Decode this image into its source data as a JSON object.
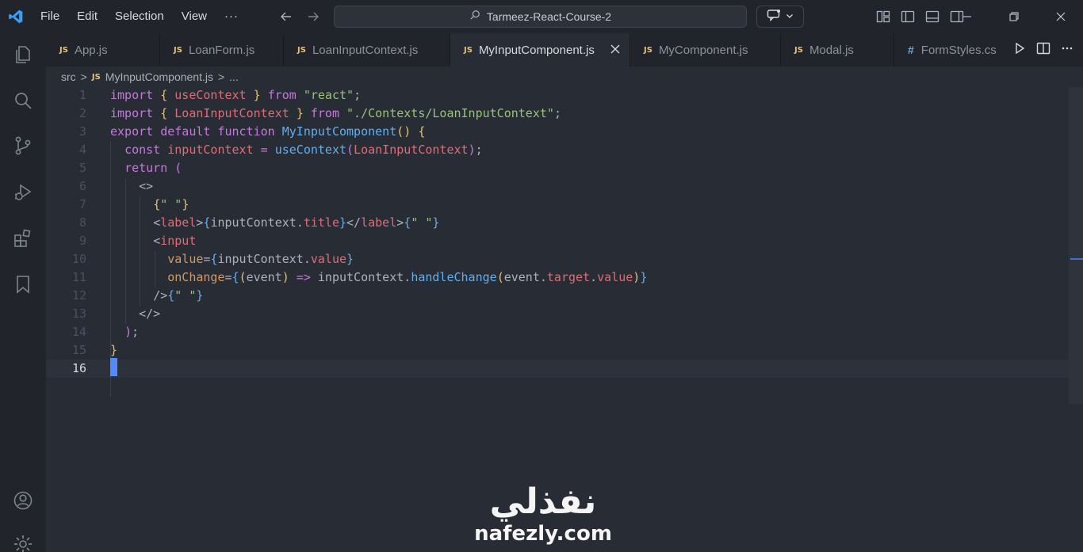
{
  "titlebar": {
    "menu": [
      "File",
      "Edit",
      "Selection",
      "View",
      "···"
    ],
    "command_center": "Tarmeez-React-Course-2"
  },
  "tabs": [
    {
      "badge": "JS",
      "label": "App.js"
    },
    {
      "badge": "JS",
      "label": "LoanForm.js"
    },
    {
      "badge": "JS",
      "label": "LoanInputContext.js"
    },
    {
      "badge": "JS",
      "label": "MyInputComponent.js",
      "active": true
    },
    {
      "badge": "JS",
      "label": "MyComponent.js"
    },
    {
      "badge": "JS",
      "label": "Modal.js"
    },
    {
      "badge": "#",
      "label": "FormStyles.cs"
    }
  ],
  "breadcrumb": {
    "folder": "src",
    "separator": ">",
    "file_badge": "JS",
    "file": "MyInputComponent.js",
    "separator2": ">",
    "symbol": "..."
  },
  "editor": {
    "current_line": 16,
    "lines": [
      {
        "n": "1",
        "tokens": [
          [
            "kw",
            "import"
          ],
          [
            "plain",
            " "
          ],
          [
            "br1",
            "{"
          ],
          [
            "plain",
            " "
          ],
          [
            "var",
            "useContext"
          ],
          [
            "plain",
            " "
          ],
          [
            "br1",
            "}"
          ],
          [
            "plain",
            " "
          ],
          [
            "kw",
            "from"
          ],
          [
            "plain",
            " "
          ],
          [
            "str",
            "\"react\""
          ],
          [
            "pun",
            ";"
          ]
        ]
      },
      {
        "n": "2",
        "tokens": [
          [
            "kw",
            "import"
          ],
          [
            "plain",
            " "
          ],
          [
            "br1",
            "{"
          ],
          [
            "plain",
            " "
          ],
          [
            "var",
            "LoanInputContext"
          ],
          [
            "plain",
            " "
          ],
          [
            "br1",
            "}"
          ],
          [
            "plain",
            " "
          ],
          [
            "kw",
            "from"
          ],
          [
            "plain",
            " "
          ],
          [
            "str",
            "\"./Contexts/LoanInputContext\""
          ],
          [
            "pun",
            ";"
          ]
        ]
      },
      {
        "n": "3",
        "tokens": [
          [
            "kw",
            "export"
          ],
          [
            "plain",
            " "
          ],
          [
            "kw",
            "default"
          ],
          [
            "plain",
            " "
          ],
          [
            "kw",
            "function"
          ],
          [
            "plain",
            " "
          ],
          [
            "fn",
            "MyInputComponent"
          ],
          [
            "br1",
            "()"
          ],
          [
            "plain",
            " "
          ],
          [
            "br1",
            "{"
          ]
        ]
      },
      {
        "n": "4",
        "tokens": [
          [
            "plain",
            "  "
          ],
          [
            "kw",
            "const"
          ],
          [
            "plain",
            " "
          ],
          [
            "var",
            "inputContext"
          ],
          [
            "plain",
            " "
          ],
          [
            "kw",
            "="
          ],
          [
            "plain",
            " "
          ],
          [
            "fn",
            "useContext"
          ],
          [
            "br2",
            "("
          ],
          [
            "var",
            "LoanInputContext"
          ],
          [
            "br2",
            ")"
          ],
          [
            "pun",
            ";"
          ]
        ]
      },
      {
        "n": "5",
        "tokens": [
          [
            "plain",
            "  "
          ],
          [
            "kw",
            "return"
          ],
          [
            "plain",
            " "
          ],
          [
            "br2",
            "("
          ]
        ]
      },
      {
        "n": "6",
        "tokens": [
          [
            "plain",
            "    "
          ],
          [
            "pun",
            "<>"
          ]
        ]
      },
      {
        "n": "7",
        "tokens": [
          [
            "plain",
            "      "
          ],
          [
            "br1",
            "{"
          ],
          [
            "str",
            "\" \""
          ],
          [
            "br1",
            "}"
          ]
        ]
      },
      {
        "n": "8",
        "tokens": [
          [
            "plain",
            "      "
          ],
          [
            "pun",
            "<"
          ],
          [
            "tag",
            "label"
          ],
          [
            "pun",
            ">"
          ],
          [
            "br3",
            "{"
          ],
          [
            "plain",
            "inputContext"
          ],
          [
            "pun",
            "."
          ],
          [
            "var",
            "title"
          ],
          [
            "br3",
            "}"
          ],
          [
            "pun",
            "</"
          ],
          [
            "tag",
            "label"
          ],
          [
            "pun",
            ">"
          ],
          [
            "br3",
            "{"
          ],
          [
            "str",
            "\" \""
          ],
          [
            "br3",
            "}"
          ]
        ]
      },
      {
        "n": "9",
        "tokens": [
          [
            "plain",
            "      "
          ],
          [
            "pun",
            "<"
          ],
          [
            "tag",
            "input"
          ]
        ]
      },
      {
        "n": "10",
        "tokens": [
          [
            "plain",
            "        "
          ],
          [
            "attr",
            "value"
          ],
          [
            "pun",
            "="
          ],
          [
            "br3",
            "{"
          ],
          [
            "plain",
            "inputContext"
          ],
          [
            "pun",
            "."
          ],
          [
            "var",
            "value"
          ],
          [
            "br3",
            "}"
          ]
        ]
      },
      {
        "n": "11",
        "tokens": [
          [
            "plain",
            "        "
          ],
          [
            "attr",
            "onChange"
          ],
          [
            "pun",
            "="
          ],
          [
            "br3",
            "{"
          ],
          [
            "br1",
            "("
          ],
          [
            "plain",
            "event"
          ],
          [
            "br1",
            ")"
          ],
          [
            "plain",
            " "
          ],
          [
            "kw",
            "=>"
          ],
          [
            "plain",
            " inputContext"
          ],
          [
            "pun",
            "."
          ],
          [
            "fn",
            "handleChange"
          ],
          [
            "br1",
            "("
          ],
          [
            "plain",
            "event"
          ],
          [
            "pun",
            "."
          ],
          [
            "var",
            "target"
          ],
          [
            "pun",
            "."
          ],
          [
            "var",
            "value"
          ],
          [
            "br1",
            ")"
          ],
          [
            "br3",
            "}"
          ]
        ]
      },
      {
        "n": "12",
        "tokens": [
          [
            "plain",
            "      "
          ],
          [
            "pun",
            "/>"
          ],
          [
            "br3",
            "{"
          ],
          [
            "str",
            "\" \""
          ],
          [
            "br3",
            "}"
          ]
        ]
      },
      {
        "n": "13",
        "tokens": [
          [
            "plain",
            "    "
          ],
          [
            "pun",
            "</>"
          ]
        ]
      },
      {
        "n": "14",
        "tokens": [
          [
            "plain",
            "  "
          ],
          [
            "br2",
            ")"
          ],
          [
            "pun",
            ";"
          ]
        ]
      },
      {
        "n": "15",
        "tokens": [
          [
            "br1",
            "}"
          ]
        ]
      },
      {
        "n": "16",
        "tokens": []
      }
    ]
  },
  "watermark": {
    "logo": "نفذلي",
    "site": "nafezly.com"
  },
  "colors": {
    "accent": "#528bff",
    "background": "#282c34",
    "chrome": "#21252b"
  }
}
